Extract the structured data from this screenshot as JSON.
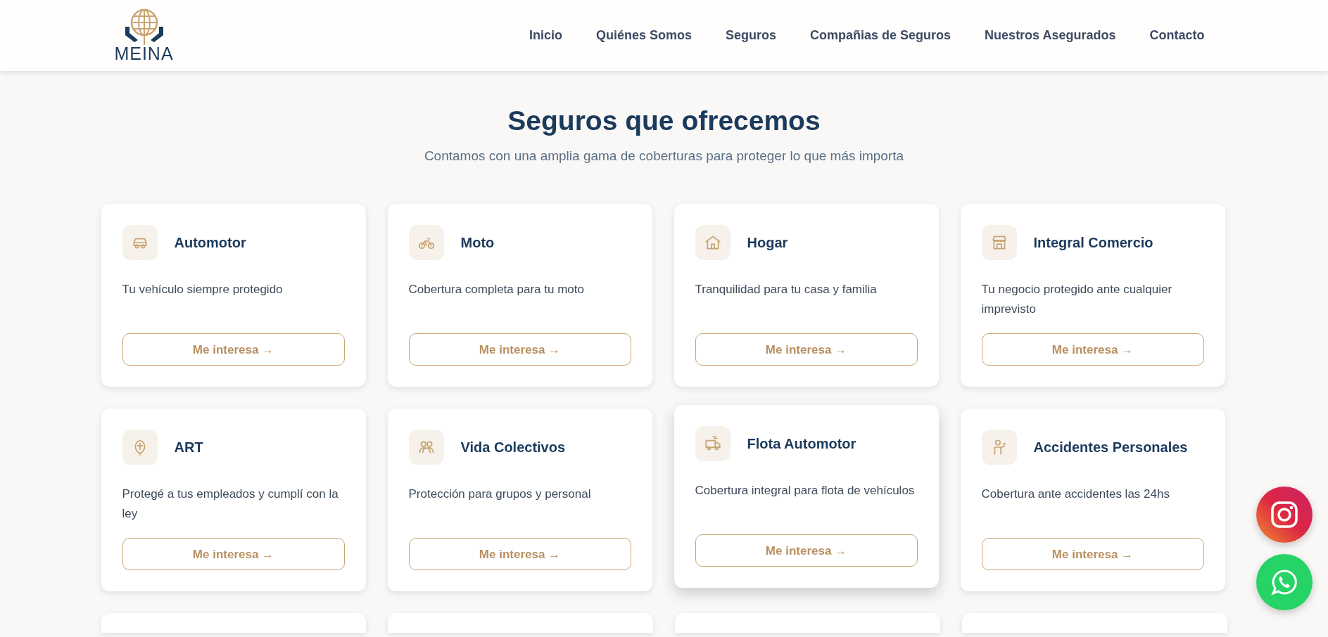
{
  "logo": {
    "text": "MEINA"
  },
  "nav": [
    {
      "label": "Inicio"
    },
    {
      "label": "Quiénes Somos"
    },
    {
      "label": "Seguros"
    },
    {
      "label": "Compañias de Seguros"
    },
    {
      "label": "Nuestros Asegurados"
    },
    {
      "label": "Contacto"
    }
  ],
  "section": {
    "title": "Seguros que ofrecemos",
    "subtitle": "Contamos con una amplia gama de coberturas para proteger lo que más importa"
  },
  "cards": [
    {
      "title": "Automotor",
      "description": "Tu vehículo siempre protegido",
      "button": "Me interesa →",
      "raised": false
    },
    {
      "title": "Moto",
      "description": "Cobertura completa para tu moto",
      "button": "Me interesa →",
      "raised": false
    },
    {
      "title": "Hogar",
      "description": "Tranquilidad para tu casa y familia",
      "button": "Me interesa →",
      "raised": false
    },
    {
      "title": "Integral Comercio",
      "description": "Tu negocio protegido ante cualquier imprevisto",
      "button": "Me interesa →",
      "raised": false
    },
    {
      "title": "ART",
      "description": "Protegé a tus empleados y cumplí con la ley",
      "button": "Me interesa →",
      "raised": false
    },
    {
      "title": "Vida Colectivos",
      "description": "Protección para grupos y personal",
      "button": "Me interesa →",
      "raised": false
    },
    {
      "title": "Flota Automotor",
      "description": "Cobertura integral para flota de vehículos",
      "button": "Me interesa →",
      "raised": true
    },
    {
      "title": "Accidentes Personales",
      "description": "Cobertura ante accidentes las 24hs",
      "button": "Me interesa →",
      "raised": false
    }
  ]
}
